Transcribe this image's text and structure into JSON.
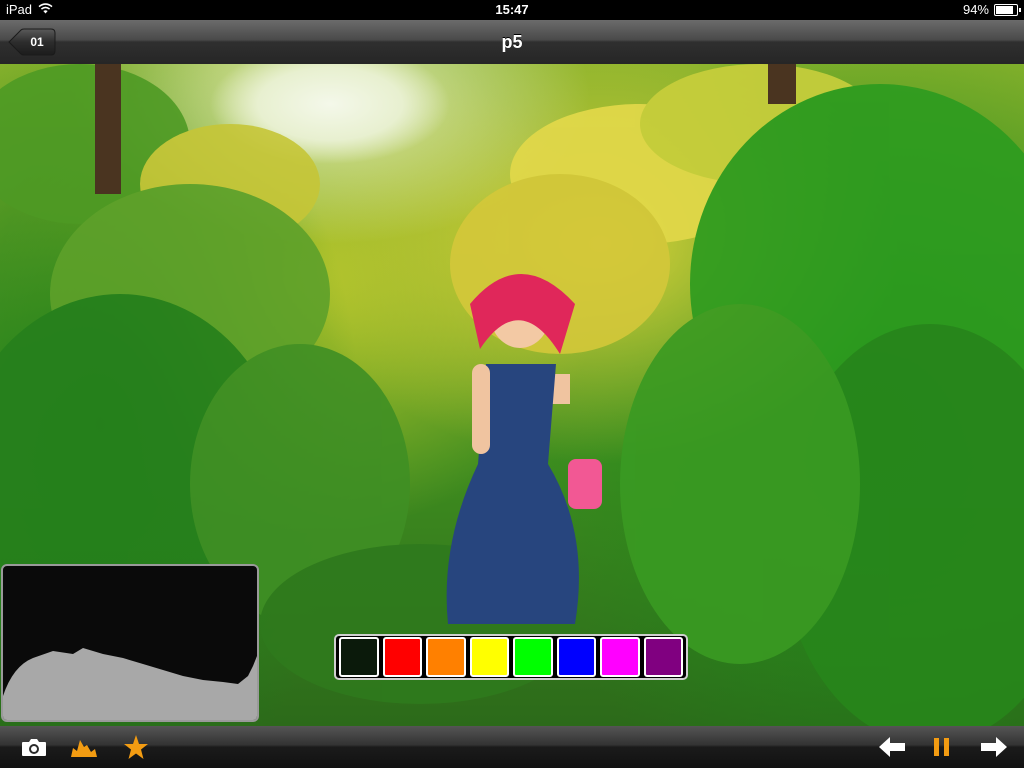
{
  "status_bar": {
    "device": "iPad",
    "time": "15:47",
    "battery_percent": "94%",
    "battery_level": 0.94
  },
  "nav_bar": {
    "back_label": "01",
    "title": "p5"
  },
  "palette": {
    "colors": [
      "#0b1a0b",
      "#ff0000",
      "#ff8000",
      "#ffff00",
      "#00ff00",
      "#0000ff",
      "#ff00ff",
      "#800080"
    ]
  },
  "toolbar": {
    "icons": [
      "camera-icon",
      "histogram-icon",
      "star-icon",
      "left-arrow-icon",
      "pause-icon",
      "right-arrow-icon"
    ],
    "accent": "#f39c12"
  }
}
